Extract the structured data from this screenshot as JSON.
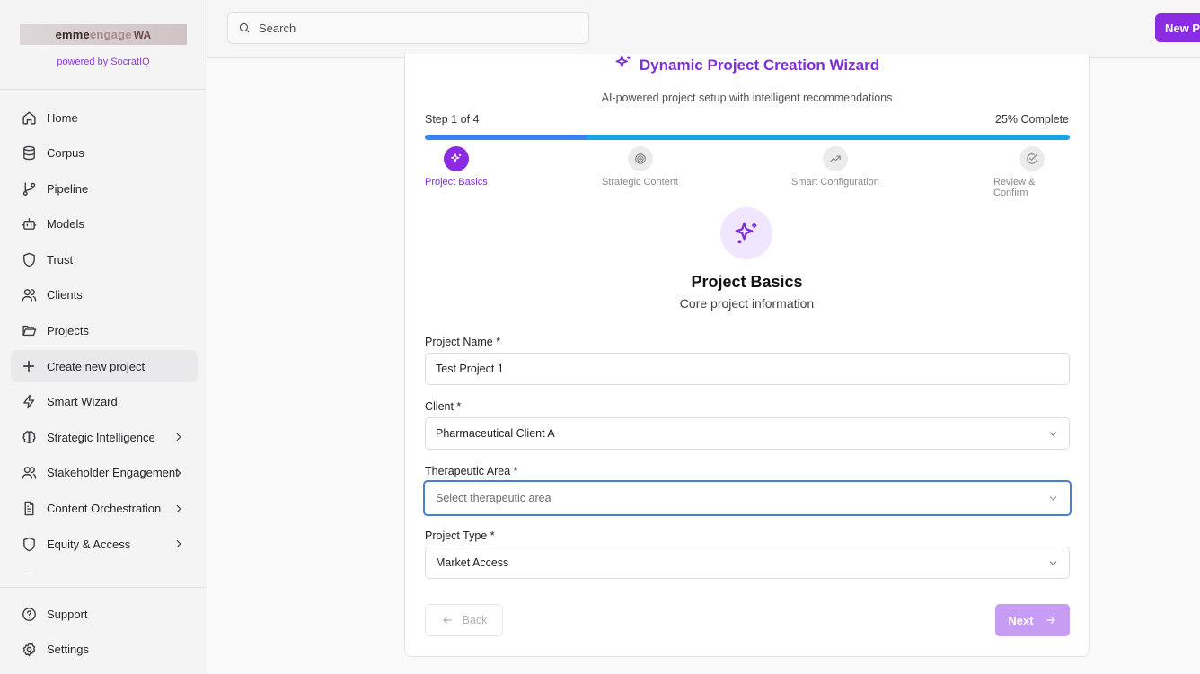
{
  "brand": {
    "logo_part1": "emme",
    "logo_part2": "engage",
    "logo_mark": "WA",
    "powered_by": "powered by SocratIQ"
  },
  "search": {
    "placeholder": "Search"
  },
  "header": {
    "new_button_label": "New Pr"
  },
  "nav": {
    "items": [
      {
        "label": "Home",
        "icon": "home-icon"
      },
      {
        "label": "Corpus",
        "icon": "database-icon"
      },
      {
        "label": "Pipeline",
        "icon": "git-branch-icon"
      },
      {
        "label": "Models",
        "icon": "bot-icon"
      },
      {
        "label": "Trust",
        "icon": "shield-icon"
      },
      {
        "label": "Clients",
        "icon": "users-icon"
      },
      {
        "label": "Projects",
        "icon": "folder-open-icon"
      },
      {
        "label": "Create new project",
        "icon": "plus-icon",
        "active": true
      },
      {
        "label": "Smart Wizard",
        "icon": "zap-icon"
      },
      {
        "label": "Strategic Intelligence",
        "icon": "brain-icon",
        "expandable": true
      },
      {
        "label": "Stakeholder Engagement",
        "icon": "users-icon",
        "expandable": true
      },
      {
        "label": "Content Orchestration",
        "icon": "file-text-icon",
        "expandable": true
      },
      {
        "label": "Equity & Access",
        "icon": "shield-icon",
        "expandable": true
      }
    ],
    "bottom": [
      {
        "label": "Support",
        "icon": "help-circle-icon"
      },
      {
        "label": "Settings",
        "icon": "gear-icon"
      }
    ]
  },
  "wizard": {
    "title": "Dynamic Project Creation Wizard",
    "subtitle": "AI-powered project setup with intelligent recommendations",
    "step_text": "Step 1 of 4",
    "complete_text": "25% Complete",
    "progress": 0.25,
    "steps": [
      {
        "label": "Project Basics",
        "icon": "sparkles-icon",
        "active": true
      },
      {
        "label": "Strategic Content",
        "icon": "target-icon"
      },
      {
        "label": "Smart Configuration",
        "icon": "trending-up-icon"
      },
      {
        "label": "Review & Confirm",
        "icon": "check-circle-icon"
      }
    ],
    "section_title": "Project Basics",
    "section_subtitle": "Core project information",
    "fields": {
      "project_name": {
        "label": "Project Name *",
        "value": "Test Project 1"
      },
      "client": {
        "label": "Client *",
        "value": "Pharmaceutical Client A"
      },
      "therapeutic_area": {
        "label": "Therapeutic Area *",
        "placeholder": "Select therapeutic area"
      },
      "project_type": {
        "label": "Project Type *",
        "value": "Market Access"
      }
    },
    "back_label": "Back",
    "next_label": "Next"
  },
  "colors": {
    "accent": "#8b2be2",
    "progress_done": "#3b82f6",
    "progress_rest": "#15a6e6",
    "focus_border": "#4a7fd0"
  }
}
